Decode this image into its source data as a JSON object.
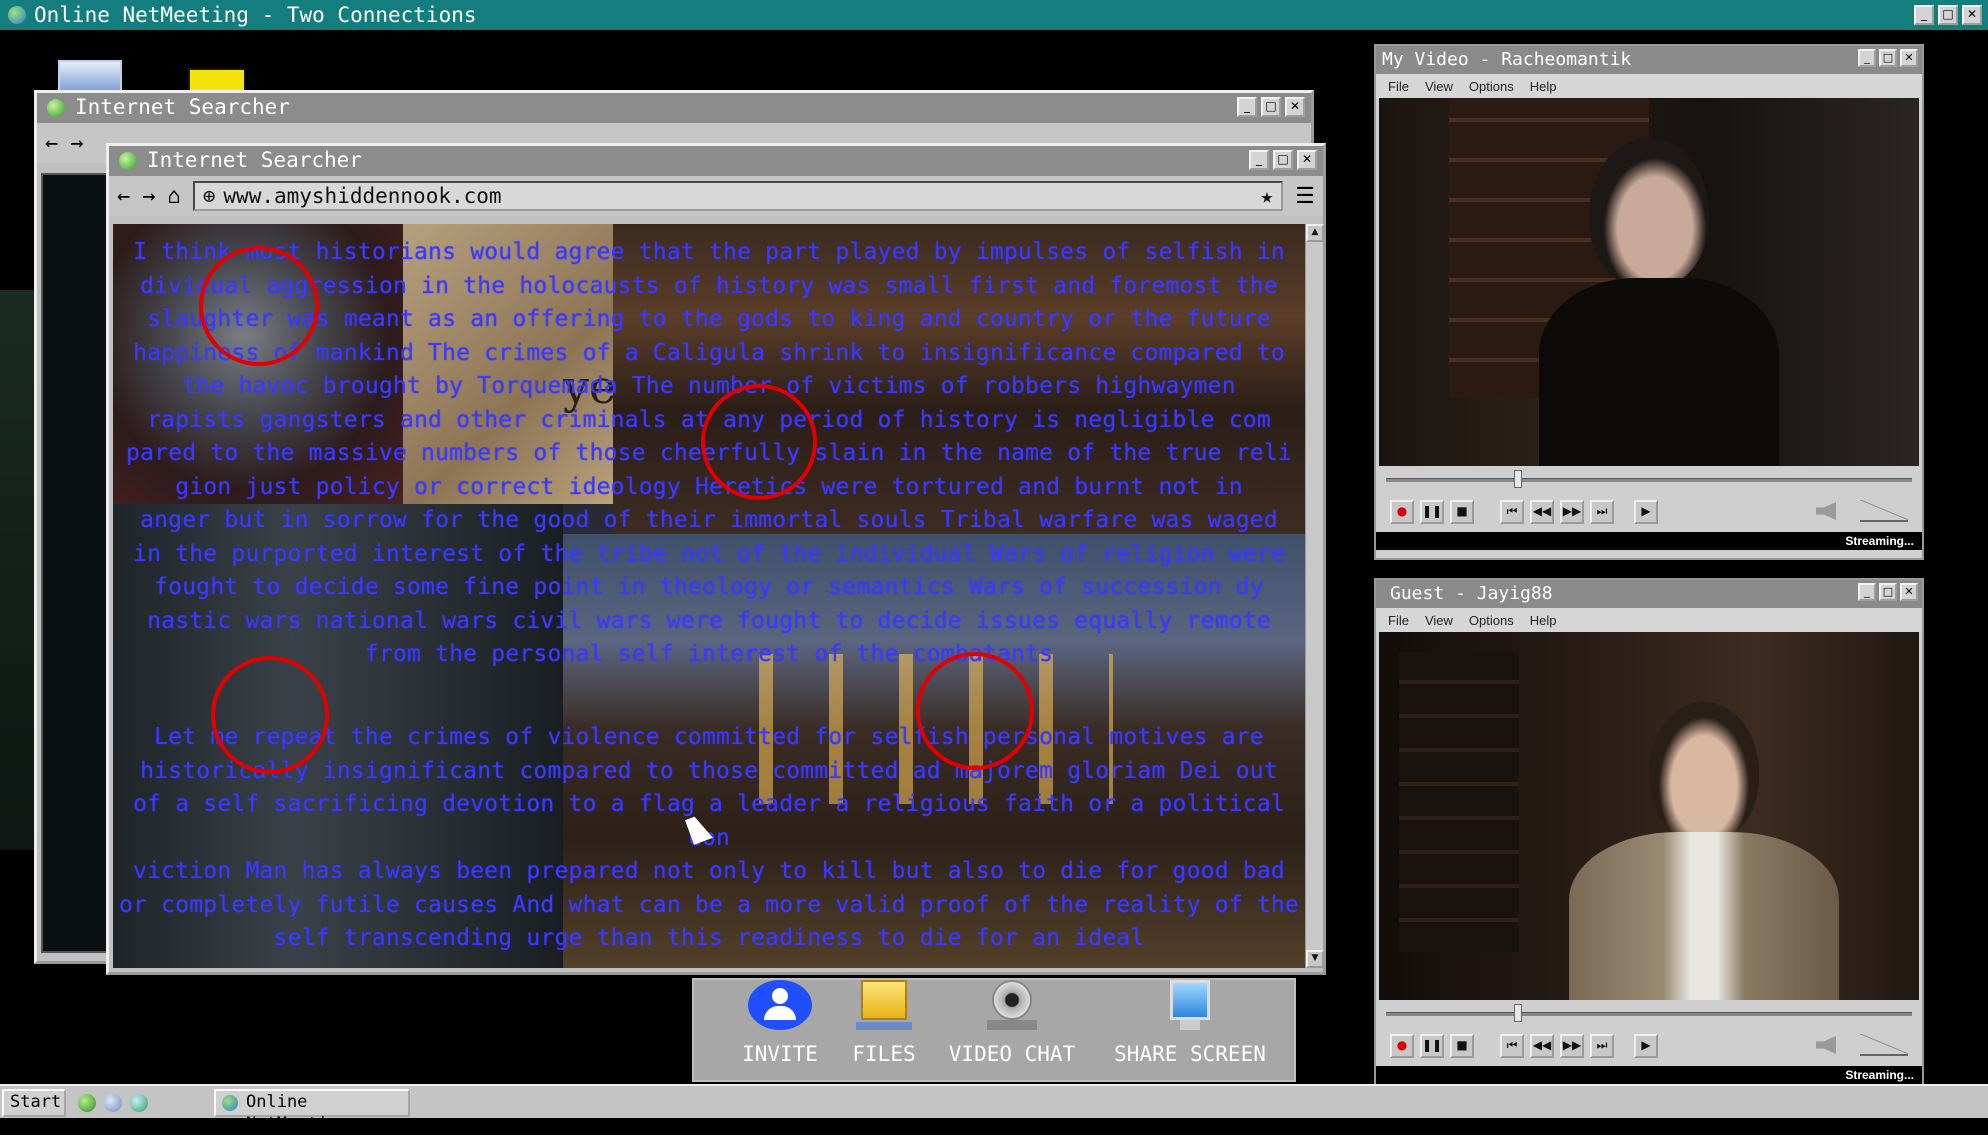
{
  "app": {
    "title": "Online NetMeeting  - Two Connections"
  },
  "title_buttons": {
    "minimize": "_",
    "maximize": "□",
    "close": "✕"
  },
  "browser_back": {
    "title": "Internet Searcher"
  },
  "browser_front": {
    "title": "Internet Searcher",
    "url": "www.amyshiddennook.com",
    "essay_paragraph_1": [
      "I think most historians would agree that the part played by impulses of selfish in",
      "dividual aggression in the holocausts of history was small first and foremost the",
      "slaughter was meant as an offering to the gods to king and country or the future",
      "happiness of mankind The crimes of a Caligula shrink to insignificance compared to",
      "the havoc brought by Torquemada The number of victims of robbers highwaymen",
      "rapists gangsters and other criminals at any period of history is negligible com",
      "pared to the massive numbers of those cheerfully slain in the name of the true reli",
      "gion just policy or correct ideology Heretics were tortured and burnt not in",
      "anger but in sorrow for the good of their immortal souls Tribal warfare was waged",
      "in the purported interest of the tribe not of the individual Wars of religion were",
      "fought to decide some fine point in theology or semantics Wars of succession dy",
      "nastic wars national wars civil wars were fought to decide issues equally remote",
      "from the personal self interest of the combatants"
    ],
    "essay_paragraph_2": [
      "Let me repeat the crimes of violence committed for selfish personal motives are",
      "historically insignificant compared to those committed ad majorem gloriam Dei out",
      "of a self sacrificing devotion to a flag a leader a religious faith or a political con",
      "viction Man has always been prepared not only to kill but also to die for good bad",
      "or completely futile causes And what can be a more valid proof of the reality of the",
      "self transcending urge than this readiness to die for an ideal"
    ],
    "collage_word": "ye"
  },
  "toolbar": {
    "invite": "INVITE",
    "files": "FILES",
    "video_chat": "VIDEO CHAT",
    "share_screen": "SHARE SCREEN"
  },
  "my_video": {
    "title": "My Video - Racheomantik",
    "menu": [
      "File",
      "View",
      "Options",
      "Help"
    ],
    "progress": 0.25,
    "status": "Streaming..."
  },
  "guest_video": {
    "title": "Guest - Jayig88",
    "menu": [
      "File",
      "View",
      "Options",
      "Help"
    ],
    "progress": 0.25,
    "status": "Streaming..."
  },
  "media_buttons": {
    "record": "●",
    "pause": "❚❚",
    "stop": "■",
    "prev": "⏮",
    "rewind": "◀◀",
    "forward": "▶▶",
    "next": "⏭",
    "play": "▶"
  },
  "taskbar": {
    "start": "Start",
    "task": "Online NetMeeting"
  },
  "colors": {
    "titlebar": "#147e7e",
    "essay_text": "#3a3aff",
    "ring": "#e00000",
    "invite_icon": "#1f4fff"
  }
}
